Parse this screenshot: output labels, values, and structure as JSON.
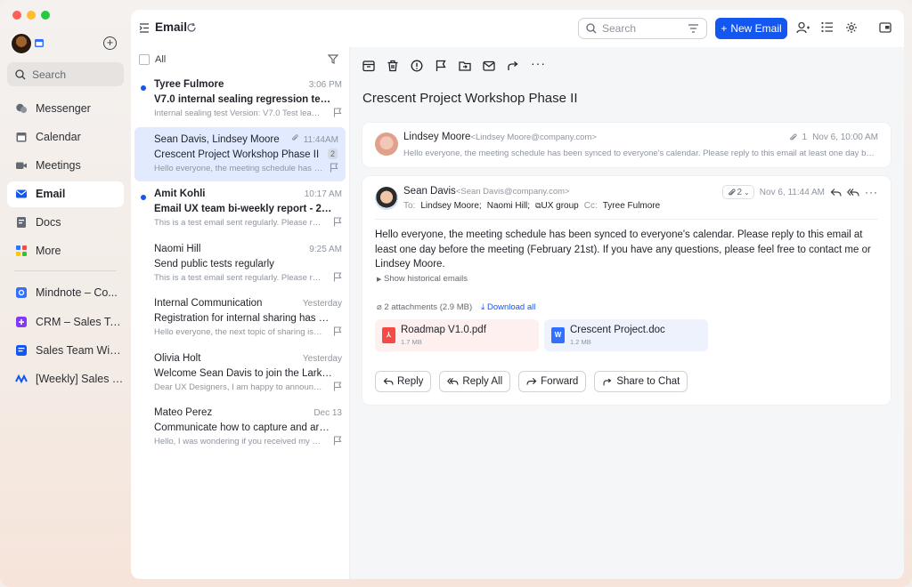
{
  "sidebar": {
    "search_placeholder": "Search",
    "items": [
      {
        "label": "Messenger",
        "active": false
      },
      {
        "label": "Calendar",
        "active": false
      },
      {
        "label": "Meetings",
        "active": false
      },
      {
        "label": "Email",
        "active": true
      },
      {
        "label": "Docs",
        "active": false
      },
      {
        "label": "More",
        "active": false
      }
    ],
    "pinned": [
      {
        "label": "Mindnote – Co...",
        "color": "#3370ff"
      },
      {
        "label": "CRM – Sales Te...",
        "color": "#7f3bf5"
      },
      {
        "label": "Sales Team Wiki...",
        "color": "#1456f0"
      },
      {
        "label": "[Weekly] Sales T...",
        "color": "#1456f0"
      }
    ]
  },
  "header": {
    "title": "Email",
    "search_placeholder": "Search",
    "new_email_label": "New Email"
  },
  "list": {
    "select_all_label": "All",
    "mails": [
      {
        "sender": "Tyree Fulmore",
        "time": "3:06 PM",
        "subject": "V7.0 internal sealing regression test rep...",
        "preview": "Internal sealing test Version: V7.0 Test leader...",
        "unread": true,
        "selected": false
      },
      {
        "sender": "Sean Davis, Lindsey Moore",
        "time": "11:44AM",
        "subject": "Crescent Project Workshop Phase II",
        "preview": "Hello everyone, the meeting schedule has be...",
        "unread": false,
        "selected": true,
        "count": "2"
      },
      {
        "sender": "Amit Kohli",
        "time": "10:17 AM",
        "subject": "Email UX team bi-weekly report - 2023/...",
        "preview": "This is a test email sent regularly. Please repl...",
        "unread": true,
        "selected": false
      },
      {
        "sender": "Naomi Hill",
        "time": "9:25 AM",
        "subject": "Send public tests regularly",
        "preview": "This is a test email sent regularly. Please repl...",
        "unread": false,
        "selected": false
      },
      {
        "sender": "Internal Communication",
        "time": "Yesterday",
        "subject": "Registration for internal sharing has starte...",
        "preview": "Hello everyone, the next topic of sharing is my...",
        "unread": false,
        "selected": false
      },
      {
        "sender": "Olivia Holt",
        "time": "Yesterday",
        "subject": "Welcome Sean Davis to join the Lark UX t...",
        "preview": "Dear UX Designers, I am happy to announce...",
        "unread": false,
        "selected": false
      },
      {
        "sender": "Mateo Perez",
        "time": "Dec 13",
        "subject": "Communicate how to capture and archive...",
        "preview": "Hello, I was wondering if you received my pr...",
        "unread": false,
        "selected": false
      }
    ]
  },
  "reader": {
    "title": "Crescent Project Workshop Phase II",
    "first": {
      "name": "Lindsey Moore",
      "address": "<Lindsey Moore@company.com>",
      "attach_count": "1",
      "date": "Nov 6, 10:00 AM",
      "preview": "Hello everyone, the meeting schedule has been synced to everyone's calendar. Please reply to this email at least one day before t..."
    },
    "second": {
      "name": "Sean Davis",
      "address": "<Sean Davis@company.com>",
      "attach_count": "2",
      "date": "Nov 6, 11:44 AM",
      "to_label": "To:",
      "to": [
        "Lindsey Moore;",
        "Naomi Hill;",
        "UX group"
      ],
      "cc_label": "Cc:",
      "cc": "Tyree Fulmore",
      "body": "Hello everyone, the meeting schedule has been synced to everyone's calendar. Please reply to this email at least one day before the meeting (February 21st). If you have any questions, please feel free to contact me or Lindsey Moore.",
      "history_label": "Show historical emails",
      "attachments_label": "2 attachments",
      "attachments_size": "(2.9 MB)",
      "download_label": "Download all",
      "files": [
        {
          "name": "Roadmap V1.0.pdf",
          "size": "1.7 MB"
        },
        {
          "name": "Crescent Project.doc",
          "size": "1.2 MB"
        }
      ],
      "actions": {
        "reply": "Reply",
        "reply_all": "Reply All",
        "forward": "Forward",
        "share": "Share to Chat"
      }
    }
  }
}
